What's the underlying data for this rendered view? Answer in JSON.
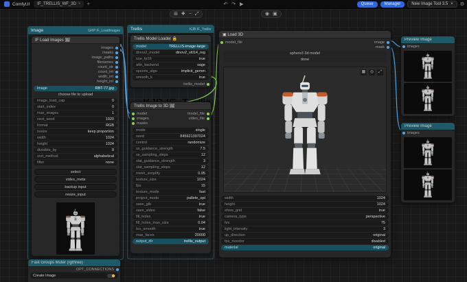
{
  "colors": {
    "accent_blue": "#2f68d8",
    "group_header_teal": "#1d5a68",
    "wire_image_blue": "#53a7e8",
    "wire_model_green": "#8bd450",
    "node_bg": "#272727",
    "canvas_bg": "#191919",
    "highlight_row": "#17505e",
    "shoulder_orange": "#c65a26"
  },
  "titlebar": {
    "app": "ComfyUI",
    "workflow_tab": "IF_TRELLIS_WF_3D",
    "tab_close": "×",
    "new_tab": "+",
    "center_icons": [
      "↶",
      "↷",
      "▶"
    ],
    "queue_button": "Queue",
    "manager_button": "Manager",
    "toast_text": "New Image Tool 3.5",
    "toast_close": "×",
    "gear_icon": "⚙"
  },
  "canvas_toolbar": {
    "icons": [
      "⊞",
      "✚",
      "−",
      "⤢"
    ]
  },
  "canvas_toolbar2": {
    "icons": [
      "◉",
      "▣"
    ]
  },
  "image_group": {
    "title": "Image",
    "tag": "GRP IF_LoadImages",
    "node": {
      "title": "IF Load Images 🖼",
      "outputs": [
        "images",
        "masks",
        "image_paths",
        "filenames",
        "count_str",
        "count_int",
        "width_int",
        "height_int"
      ],
      "widgets": [
        {
          "label": "image",
          "value": "RBT-77.jpg",
          "cls": "hl"
        },
        {
          "label": "",
          "value": "choose file to upload",
          "cls": "btnrow"
        },
        {
          "label": "image_load_cap",
          "value": "0"
        },
        {
          "label": "start_index",
          "value": "0"
        },
        {
          "label": "max_images",
          "value": "1"
        },
        {
          "label": "next_seed",
          "value": "1920"
        },
        {
          "label": "format",
          "value": "RGB"
        },
        {
          "label": "resize",
          "value": "keep proportion"
        },
        {
          "label": "width",
          "value": "1024"
        },
        {
          "label": "height",
          "value": "1024"
        },
        {
          "label": "divisible_by",
          "value": "8"
        },
        {
          "label": "sort_method",
          "value": "alphabetical"
        },
        {
          "label": "filter",
          "value": "none"
        }
      ],
      "buttons": [
        "select",
        "video_meta",
        "backup input",
        "resize_input"
      ],
      "preview_name": "robot-image-preview"
    }
  },
  "trellis_group": {
    "title": "Trellis",
    "tag": "KJB IF_Trellis",
    "tag2": "KJB IF_Trellis",
    "loader": {
      "title": "Trellis Model Loader 🔒",
      "output": "trellis_model",
      "widgets": [
        {
          "label": "model",
          "value": "TRELLIS-image-large",
          "cls": "hl"
        },
        {
          "label": "dinov2_model",
          "value": "dinov2_vitl14_reg"
        },
        {
          "label": "use_fp16",
          "value": "true"
        },
        {
          "label": "attn_backend",
          "value": "sage"
        },
        {
          "label": "spconv_algo",
          "value": "implicit_gemm"
        },
        {
          "label": "smooth_k",
          "value": "true"
        }
      ]
    },
    "to3d": {
      "title": "Trellis Image to 3D 🖼",
      "inputs": [
        "model",
        "images",
        "masks"
      ],
      "outputs": [
        "model_file",
        "video_file"
      ],
      "widgets": [
        {
          "label": "mode",
          "value": "single"
        },
        {
          "label": "seed",
          "value": "845621397024"
        },
        {
          "label": "control",
          "value": "randomize"
        },
        {
          "label": "ss_guidance_strength",
          "value": "7.5"
        },
        {
          "label": "ss_sampling_steps",
          "value": "12"
        },
        {
          "label": "slat_guidance_strength",
          "value": "3"
        },
        {
          "label": "slat_sampling_steps",
          "value": "12"
        },
        {
          "label": "mesh_simplify",
          "value": "0.95"
        },
        {
          "label": "texture_size",
          "value": "1024"
        },
        {
          "label": "fps",
          "value": "15"
        },
        {
          "label": "texture_mode",
          "value": "fast"
        },
        {
          "label": "project_mode",
          "value": "pallete_opt"
        },
        {
          "label": "save_glb",
          "value": "true"
        },
        {
          "label": "save_video",
          "value": "false"
        },
        {
          "label": "fill_holes",
          "value": "true"
        },
        {
          "label": "fill_holes_max_size",
          "value": "0.04"
        },
        {
          "label": "tex_smooth",
          "value": "true"
        },
        {
          "label": "max_faces",
          "value": "20000"
        },
        {
          "label": "output_dir",
          "value": "trellis_output",
          "cls": "hl"
        }
      ]
    }
  },
  "load3d": {
    "title": "Load 3D",
    "header_icon": "▣",
    "input": "model_file",
    "outputs": [
      "image",
      "mask"
    ],
    "model_row": "sphere3 3d model",
    "action_row": "done",
    "viewport_icons": [
      "▦",
      "◎",
      "⤢"
    ],
    "widgets": [
      {
        "label": "width",
        "value": "1024"
      },
      {
        "label": "height",
        "value": "1024"
      },
      {
        "label": "show_grid",
        "value": "true"
      },
      {
        "label": "camera_type",
        "value": "perspective"
      },
      {
        "label": "fov",
        "value": "75"
      },
      {
        "label": "light_intensity",
        "value": "3"
      },
      {
        "label": "up_direction",
        "value": "original"
      },
      {
        "label": "fps_monitor",
        "value": "disabled"
      },
      {
        "label": "material",
        "value": "original",
        "cls": "hl"
      }
    ]
  },
  "preview1": {
    "title": "Preview Image",
    "input": "images",
    "thumbs": [
      "robot-render-front",
      "robot-render-side"
    ]
  },
  "preview2": {
    "title": "Preview Image",
    "input": "images",
    "thumbs": [
      "robot-render-back",
      "robot-render-angle"
    ]
  },
  "muter": {
    "title": "Fast Groups Muter (rgthree)",
    "output": "OPT_CONNECTIONS",
    "rows": [
      {
        "label": "Create Image"
      }
    ]
  }
}
